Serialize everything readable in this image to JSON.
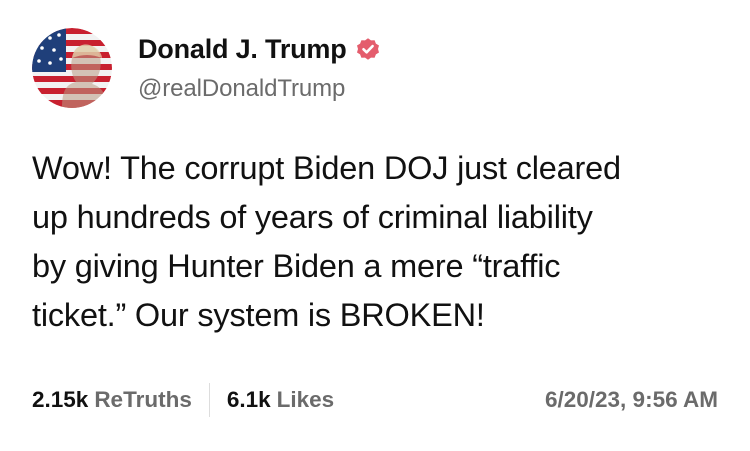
{
  "author": {
    "display_name": "Donald J. Trump",
    "handle": "@realDonaldTrump",
    "verified": true,
    "verified_badge_color": "#e45d6d",
    "avatar_icon": "flag-portrait-avatar"
  },
  "post": {
    "lines": [
      "Wow! The corrupt Biden DOJ just cleared",
      "up hundreds of years of criminal liability",
      "by giving Hunter Biden a mere “traffic",
      "ticket.” Our system is BROKEN!"
    ]
  },
  "stats": {
    "retruths_count": "2.15k",
    "retruths_label": "ReTruths",
    "likes_count": "6.1k",
    "likes_label": "Likes",
    "timestamp": "6/20/23, 9:56 AM"
  },
  "colors": {
    "text_primary": "#111111",
    "text_secondary": "#6b6b6b",
    "divider": "#dddddd"
  }
}
